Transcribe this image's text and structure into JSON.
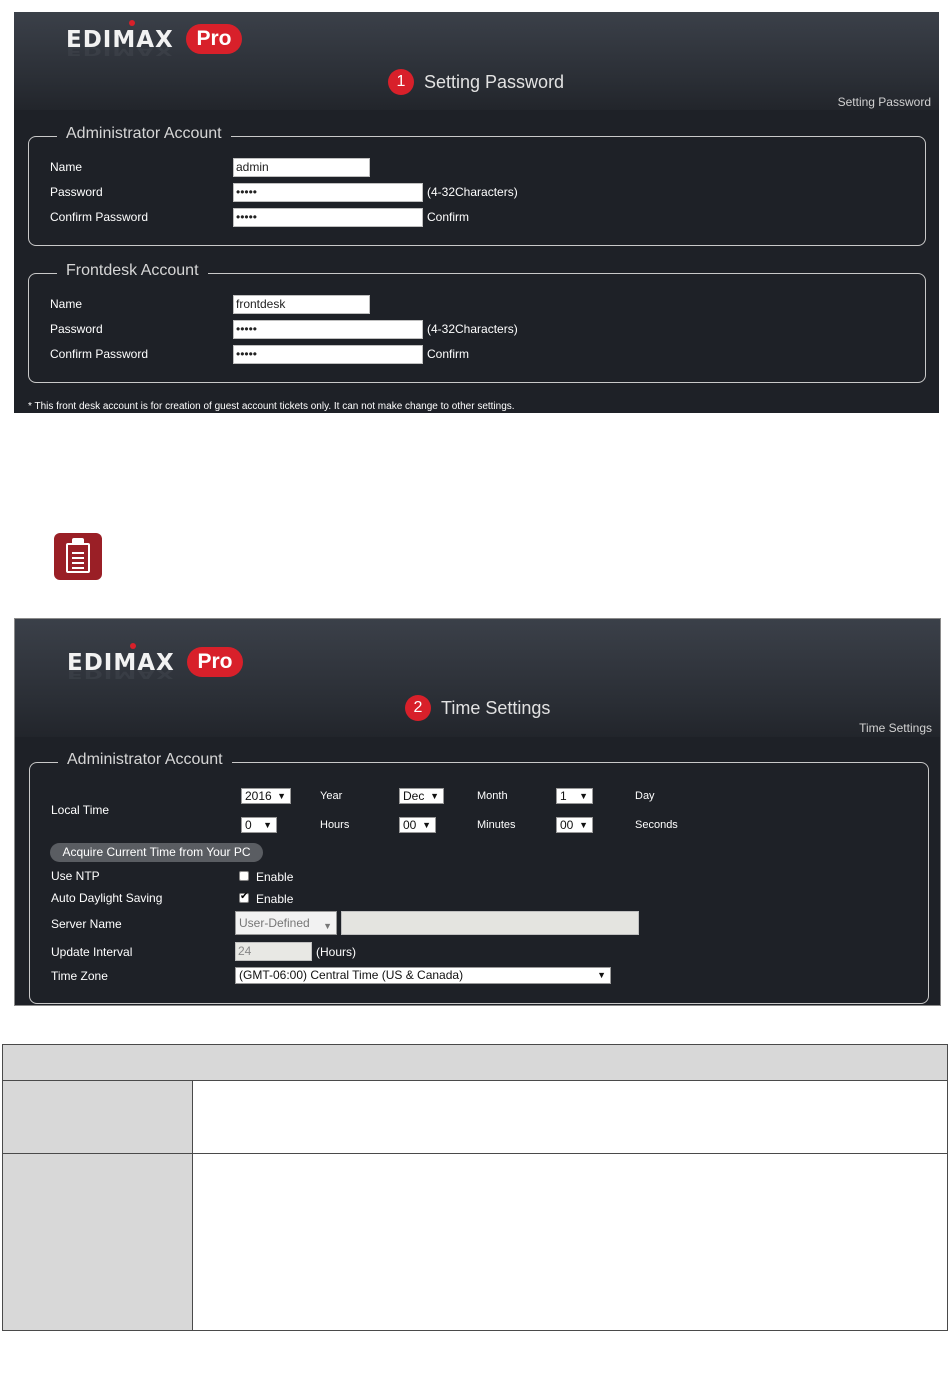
{
  "panel1": {
    "brand": {
      "name": "EDIMAX",
      "suffix": "Pro"
    },
    "step_number": "1",
    "step_title": "Setting Password",
    "breadcrumb": "Setting Password",
    "admin": {
      "legend": "Administrator Account",
      "name_label": "Name",
      "name_value": "admin",
      "password_label": "Password",
      "password_value": "•••••",
      "password_hint": "(4-32Characters)",
      "confirm_label": "Confirm Password",
      "confirm_value": "•••••",
      "confirm_hint": "Confirm"
    },
    "frontdesk": {
      "legend": "Frontdesk Account",
      "name_label": "Name",
      "name_value": "frontdesk",
      "password_label": "Password",
      "password_value": "•••••",
      "password_hint": "(4-32Characters)",
      "confirm_label": "Confirm Password",
      "confirm_value": "•••••",
      "confirm_hint": "Confirm"
    },
    "footnote": "* This front desk account is for creation of guest account tickets only. It can not make change to other settings."
  },
  "note_icon": "clipboard-icon",
  "panel2": {
    "brand": {
      "name": "EDIMAX",
      "suffix": "Pro"
    },
    "step_number": "2",
    "step_title": "Time Settings",
    "breadcrumb": "Time Settings",
    "legend": "Administrator Account",
    "local_time_label": "Local Time",
    "year_value": "2016",
    "year_label": "Year",
    "month_value": "Dec",
    "month_label": "Month",
    "day_value": "1",
    "day_label": "Day",
    "hour_value": "0",
    "hour_label": "Hours",
    "minute_value": "00",
    "minute_label": "Minutes",
    "second_value": "00",
    "second_label": "Seconds",
    "acquire_button": "Acquire Current Time from Your PC",
    "use_ntp_label": "Use NTP",
    "use_ntp_enable": "Enable",
    "use_ntp_checked": false,
    "daylight_label": "Auto Daylight Saving",
    "daylight_enable": "Enable",
    "daylight_checked": true,
    "server_name_label": "Server Name",
    "server_name_select": "User-Defined",
    "server_name_value": "",
    "update_interval_label": "Update Interval",
    "update_interval_value": "24",
    "update_interval_unit": "(Hours)",
    "time_zone_label": "Time Zone",
    "time_zone_value": "(GMT-06:00) Central Time (US & Canada)"
  },
  "colors": {
    "brand_red": "#d8202a",
    "panel_bg": "#1e2127"
  }
}
